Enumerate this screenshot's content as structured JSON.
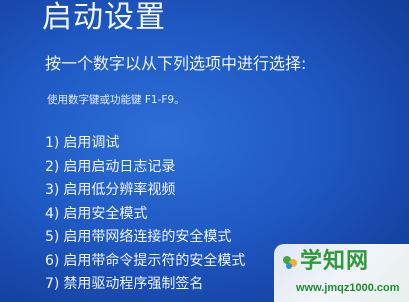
{
  "screen": {
    "title": "启动设置",
    "subtitle": "按一个数字以从下列选项中进行选择:",
    "hint": "使用数字键或功能键 F1-F9。"
  },
  "options": [
    {
      "number": "1)",
      "label": "启用调试"
    },
    {
      "number": "2)",
      "label": "启用启动日志记录"
    },
    {
      "number": "3)",
      "label": "启用低分辨率视频"
    },
    {
      "number": "4)",
      "label": "启用安全模式"
    },
    {
      "number": "5)",
      "label": "启用带网络连接的安全模式"
    },
    {
      "number": "6)",
      "label": "启用带命令提示符的安全模式"
    },
    {
      "number": "7)",
      "label": "禁用驱动程序强制签名"
    }
  ],
  "watermark": {
    "text": "学知网",
    "url": "www.jmqz1000.com",
    "color": "#2f9a3a"
  },
  "colors": {
    "background": "#1f59c4",
    "text": "#f2f6ff"
  }
}
